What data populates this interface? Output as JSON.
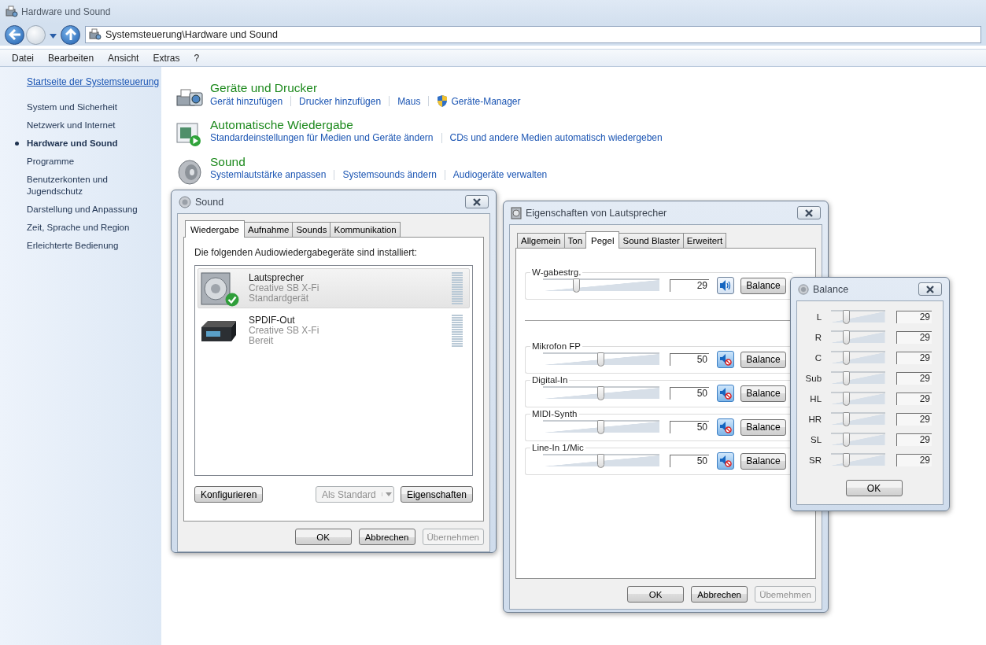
{
  "window": {
    "title": "Hardware und Sound"
  },
  "address": {
    "path": "Systemsteuerung\\Hardware und Sound"
  },
  "menu": [
    "Datei",
    "Bearbeiten",
    "Ansicht",
    "Extras",
    "?"
  ],
  "sidebar": {
    "home_link": "Startseite der Systemsteuerung",
    "items": [
      {
        "label": "System und Sicherheit",
        "selected": false
      },
      {
        "label": "Netzwerk und Internet",
        "selected": false
      },
      {
        "label": "Hardware und Sound",
        "selected": true
      },
      {
        "label": "Programme",
        "selected": false
      },
      {
        "label": "Benutzerkonten und Jugendschutz",
        "selected": false
      },
      {
        "label": "Darstellung und Anpassung",
        "selected": false
      },
      {
        "label": "Zeit, Sprache und Region",
        "selected": false
      },
      {
        "label": "Erleichterte Bedienung",
        "selected": false
      }
    ]
  },
  "categories": [
    {
      "title": "Geräte und Drucker",
      "kind": "printer",
      "links": [
        {
          "label": "Gerät hinzufügen",
          "shield": false
        },
        {
          "label": "Drucker hinzufügen",
          "shield": false
        },
        {
          "label": "Maus",
          "shield": false
        },
        {
          "label": "Geräte-Manager",
          "shield": true
        }
      ]
    },
    {
      "title": "Automatische Wiedergabe",
      "kind": "autoplay",
      "links": [
        {
          "label": "Standardeinstellungen für Medien und Geräte ändern",
          "shield": false
        },
        {
          "label": "CDs und andere Medien automatisch wiedergeben",
          "shield": false
        }
      ]
    },
    {
      "title": "Sound",
      "kind": "speaker",
      "links": [
        {
          "label": "Systemlautstärke anpassen",
          "shield": false
        },
        {
          "label": "Systemsounds ändern",
          "shield": false
        },
        {
          "label": "Audiogeräte verwalten",
          "shield": false
        }
      ]
    }
  ],
  "sound_dialog": {
    "title": "Sound",
    "tabs": [
      {
        "label": "Wiedergabe",
        "selected": true
      },
      {
        "label": "Aufnahme",
        "selected": false
      },
      {
        "label": "Sounds",
        "selected": false
      },
      {
        "label": "Kommunikation",
        "selected": false
      }
    ],
    "intro": "Die folgenden Audiowiedergabegeräte sind installiert:",
    "devices": [
      {
        "name": "Lautsprecher",
        "driver": "Creative SB X-Fi",
        "status": "Standardgerät",
        "kind": "speaker",
        "default": true,
        "selected": true
      },
      {
        "name": "SPDIF-Out",
        "driver": "Creative SB X-Fi",
        "status": "Bereit",
        "kind": "receiver",
        "default": false,
        "selected": false
      }
    ],
    "configure": {
      "label": "Konfigurieren",
      "disabled": false
    },
    "set_default": {
      "label": "Als Standard",
      "disabled": true
    },
    "properties": {
      "label": "Eigenschaften",
      "disabled": false
    },
    "footer": [
      {
        "label": "OK",
        "disabled": false
      },
      {
        "label": "Abbrechen",
        "disabled": false
      },
      {
        "label": "Übernehmen",
        "disabled": true
      }
    ]
  },
  "properties_dialog": {
    "title": "Eigenschaften von Lautsprecher",
    "tabs": [
      {
        "label": "Allgemein",
        "selected": false
      },
      {
        "label": "Ton",
        "selected": false
      },
      {
        "label": "Pegel",
        "selected": true
      },
      {
        "label": "Sound Blaster",
        "selected": false
      },
      {
        "label": "Erweitert",
        "selected": false
      }
    ],
    "master": {
      "name": "W-gabestrg.",
      "level": 0.29,
      "reading": "29",
      "muted": false,
      "balance": "Balance"
    },
    "channels": [
      {
        "name": "Mikrofon FP",
        "level": 0.5,
        "reading": "50",
        "muted": true,
        "balance": "Balance"
      },
      {
        "name": "Digital-In",
        "level": 0.5,
        "reading": "50",
        "muted": true,
        "balance": "Balance"
      },
      {
        "name": "MIDI-Synth",
        "level": 0.5,
        "reading": "50",
        "muted": true,
        "balance": "Balance"
      },
      {
        "name": "Line-In 1/Mic",
        "level": 0.5,
        "reading": "50",
        "muted": true,
        "balance": "Balance"
      }
    ],
    "footer": [
      {
        "label": "OK",
        "disabled": false
      },
      {
        "label": "Abbrechen",
        "disabled": false
      },
      {
        "label": "Übemehmen",
        "disabled": true
      }
    ]
  },
  "balance_dialog": {
    "title": "Balance",
    "channels": [
      {
        "name": "L",
        "level": 0.29,
        "reading": "29"
      },
      {
        "name": "R",
        "level": 0.29,
        "reading": "29"
      },
      {
        "name": "C",
        "level": 0.29,
        "reading": "29"
      },
      {
        "name": "Sub",
        "level": 0.29,
        "reading": "29"
      },
      {
        "name": "HL",
        "level": 0.29,
        "reading": "29"
      },
      {
        "name": "HR",
        "level": 0.29,
        "reading": "29"
      },
      {
        "name": "SL",
        "level": 0.29,
        "reading": "29"
      },
      {
        "name": "SR",
        "level": 0.29,
        "reading": "29"
      }
    ],
    "ok": "OK"
  }
}
